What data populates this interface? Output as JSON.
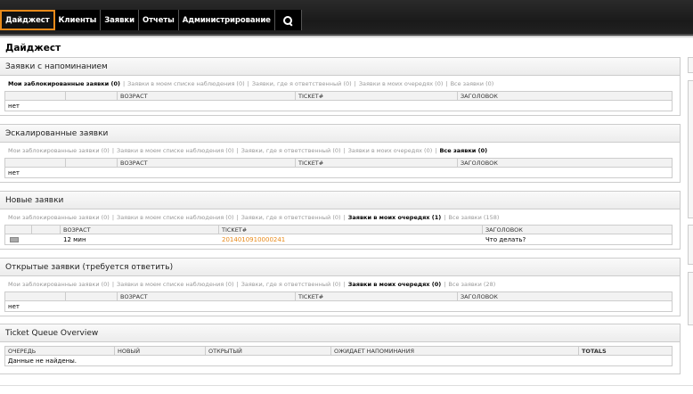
{
  "nav": {
    "items": [
      {
        "label": "Дайджест"
      },
      {
        "label": "Клиенты"
      },
      {
        "label": "Заявки"
      },
      {
        "label": "Отчеты"
      },
      {
        "label": "Администрирование"
      }
    ],
    "search_icon": "search-icon"
  },
  "page_title": "Дайджест",
  "widgets": {
    "reminder": {
      "title": "Заявки с напоминанием",
      "filters": [
        "Мои заблокированные заявки (0)",
        "Заявки в моем списке наблюдения (0)",
        "Заявки, где я ответственный (0)",
        "Заявки в моих очередях (0)",
        "Все заявки (0)"
      ],
      "headers": [
        "ВОЗРАСТ",
        "TICKET#",
        "ЗАГОЛОВОК"
      ],
      "empty": "нет"
    },
    "escalated": {
      "title": "Эскалированные заявки",
      "filters": [
        "Мои заблокированные заявки (0)",
        "Заявки в моем списке наблюдения (0)",
        "Заявки, где я ответственный (0)",
        "Заявки в моих очередях (0)",
        "Все заявки (0)"
      ],
      "headers": [
        "ВОЗРАСТ",
        "TICKET#",
        "ЗАГОЛОВОК"
      ],
      "empty": "нет"
    },
    "new": {
      "title": "Новые заявки",
      "filters": [
        "Мои заблокированные заявки (0)",
        "Заявки в моем списке наблюдения (0)",
        "Заявки, где я ответственный (0)",
        "Заявки в моих очередях (1)",
        "Все заявки (158)"
      ],
      "headers": [
        "ВОЗРАСТ",
        "TICKET#",
        "ЗАГОЛОВОК"
      ],
      "row": {
        "age": "12 мин",
        "ticket": "2014010910000241",
        "title": "Что делать?"
      }
    },
    "open": {
      "title": "Открытые заявки (требуется ответить)",
      "filters": [
        "Мои заблокированные заявки (0)",
        "Заявки в моем списке наблюдения (0)",
        "Заявки, где я ответственный (0)",
        "Заявки в моих очередях (0)",
        "Все заявки (28)"
      ],
      "headers": [
        "ВОЗРАСТ",
        "TICKET#",
        "ЗАГОЛОВОК"
      ],
      "empty": "нет"
    },
    "queue": {
      "title": "Ticket Queue Overview",
      "headers": [
        "ОЧЕРЕДЬ",
        "НОВЫЙ",
        "ОТКРЫТЫЙ",
        "ОЖИДАЕТ НАПОМИНАНИЯ",
        "TOTALS"
      ],
      "empty": "Данные не найдены."
    }
  }
}
